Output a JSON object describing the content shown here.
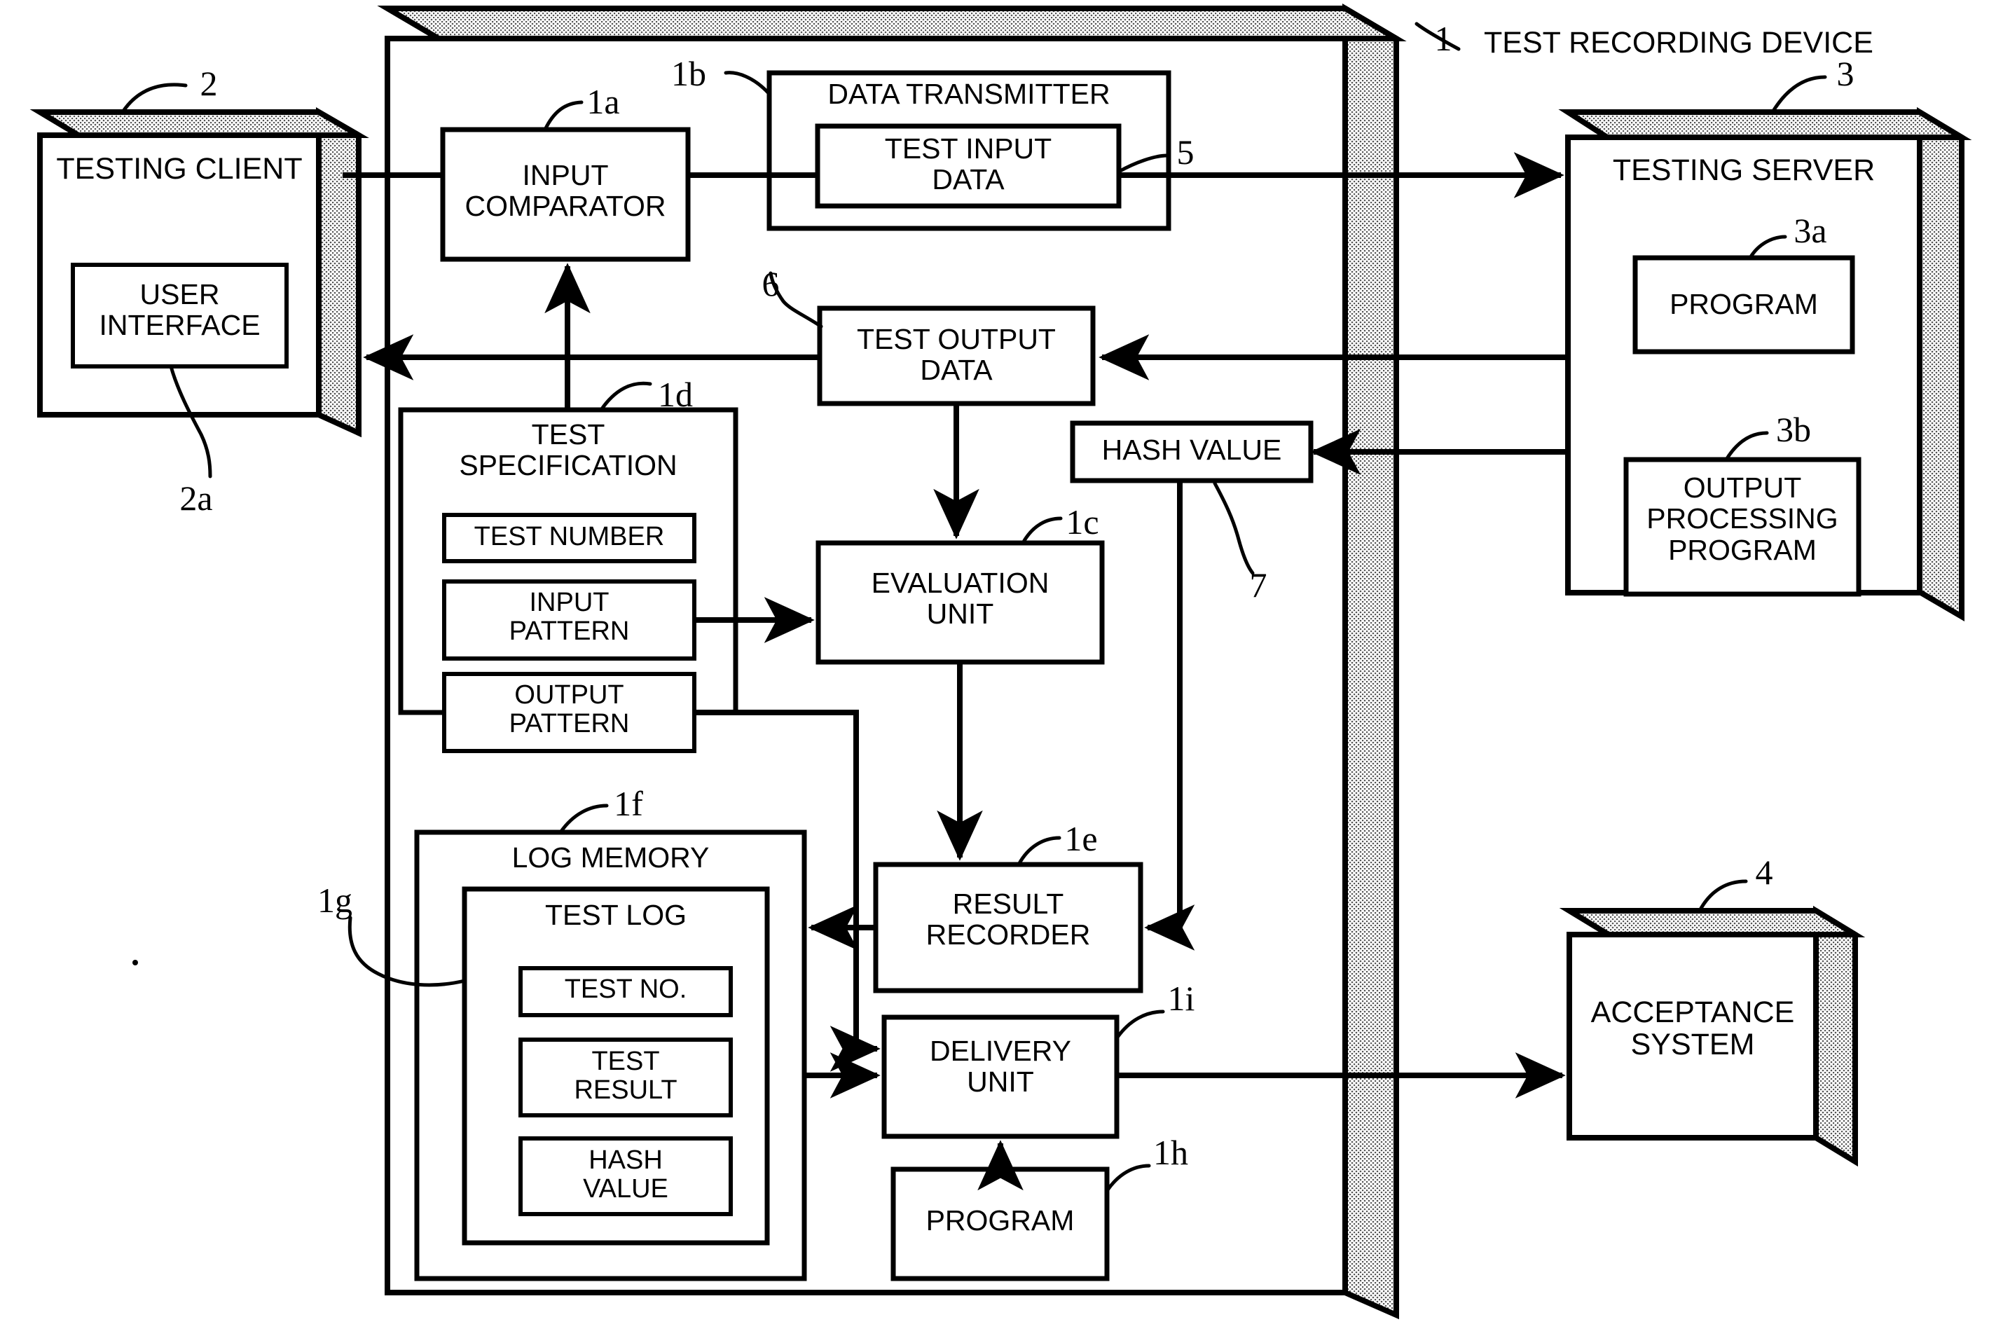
{
  "diagram": {
    "title_ref": "1",
    "title_text": "TEST RECORDING DEVICE",
    "type": "patent-block-diagram"
  },
  "nodes": {
    "testing_client": {
      "label": "TESTING CLIENT",
      "ref": "2"
    },
    "user_interface": {
      "label": "USER\nINTERFACE",
      "ref": "2a"
    },
    "input_comparator": {
      "label": "INPUT\nCOMPARATOR",
      "ref": "1a"
    },
    "data_transmitter": {
      "label": "DATA TRANSMITTER",
      "ref": "1b"
    },
    "test_input_data": {
      "label": "TEST INPUT\nDATA",
      "ref": "5"
    },
    "testing_server": {
      "label": "TESTING SERVER",
      "ref": "3"
    },
    "program_server": {
      "label": "PROGRAM",
      "ref": "3a"
    },
    "output_processing_program": {
      "label": "OUTPUT\nPROCESSING\nPROGRAM",
      "ref": "3b"
    },
    "test_output_data": {
      "label": "TEST OUTPUT\nDATA",
      "ref": "6"
    },
    "hash_value_bus": {
      "label": "HASH VALUE",
      "ref": "7"
    },
    "test_specification": {
      "label": "TEST\nSPECIFICATION",
      "ref": "1d"
    },
    "test_number": {
      "label": "TEST NUMBER",
      "ref": ""
    },
    "input_pattern": {
      "label": "INPUT\nPATTERN",
      "ref": ""
    },
    "output_pattern": {
      "label": "OUTPUT\nPATTERN",
      "ref": ""
    },
    "evaluation_unit": {
      "label": "EVALUATION\nUNIT",
      "ref": "1c"
    },
    "result_recorder": {
      "label": "RESULT\nRECORDER",
      "ref": "1e"
    },
    "log_memory": {
      "label": "LOG MEMORY",
      "ref": "1f"
    },
    "test_log": {
      "label": "TEST LOG",
      "ref": "1g"
    },
    "test_no": {
      "label": "TEST NO.",
      "ref": ""
    },
    "test_result": {
      "label": "TEST\nRESULT",
      "ref": ""
    },
    "hash_value_log": {
      "label": "HASH\nVALUE",
      "ref": ""
    },
    "delivery_unit": {
      "label": "DELIVERY\nUNIT",
      "ref": "1i"
    },
    "program_delivery": {
      "label": "PROGRAM",
      "ref": "1h"
    },
    "acceptance_system": {
      "label": "ACCEPTANCE\nSYSTEM",
      "ref": "4"
    }
  },
  "colors": {
    "line": "#000000",
    "fill": "#ffffff"
  }
}
